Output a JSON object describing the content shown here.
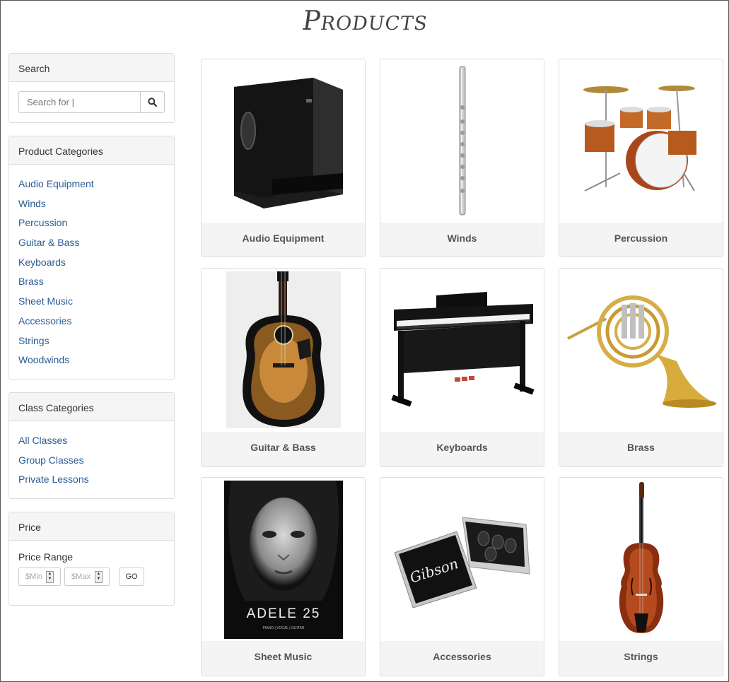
{
  "page": {
    "title": "Products"
  },
  "sidebar": {
    "search": {
      "heading": "Search",
      "placeholder": "Search for |",
      "icon": "search-icon"
    },
    "product_categories": {
      "heading": "Product Categories",
      "items": [
        "Audio Equipment",
        "Winds",
        "Percussion",
        "Guitar & Bass",
        "Keyboards",
        "Brass",
        "Sheet Music",
        "Accessories",
        "Strings",
        "Woodwinds"
      ]
    },
    "class_categories": {
      "heading": "Class Categories",
      "items": [
        "All Classes",
        "Group Classes",
        "Private Lessons"
      ]
    },
    "price": {
      "heading": "Price",
      "range_label": "Price Range",
      "min_placeholder": "$Min",
      "max_placeholder": "$Max",
      "go_label": "GO"
    }
  },
  "products": [
    {
      "label": "Audio Equipment",
      "image": "subwoofer-speaker"
    },
    {
      "label": "Winds",
      "image": "flute"
    },
    {
      "label": "Percussion",
      "image": "drum-kit"
    },
    {
      "label": "Guitar & Bass",
      "image": "acoustic-guitar"
    },
    {
      "label": "Keyboards",
      "image": "digital-piano"
    },
    {
      "label": "Brass",
      "image": "french-horn"
    },
    {
      "label": "Sheet Music",
      "image": "adele-25-songbook"
    },
    {
      "label": "Accessories",
      "image": "gibson-pick-tin"
    },
    {
      "label": "Strings",
      "image": "violin"
    }
  ],
  "images_text": {
    "songbook_title": "ADELE 25",
    "songbook_sub": "PIANO | VOCAL | GUITAR",
    "tin_brand": "Gibson"
  },
  "colors": {
    "link": "#2a5d93",
    "caption_bg": "#f4f4f4",
    "panel_heading_bg": "#f5f5f5"
  }
}
